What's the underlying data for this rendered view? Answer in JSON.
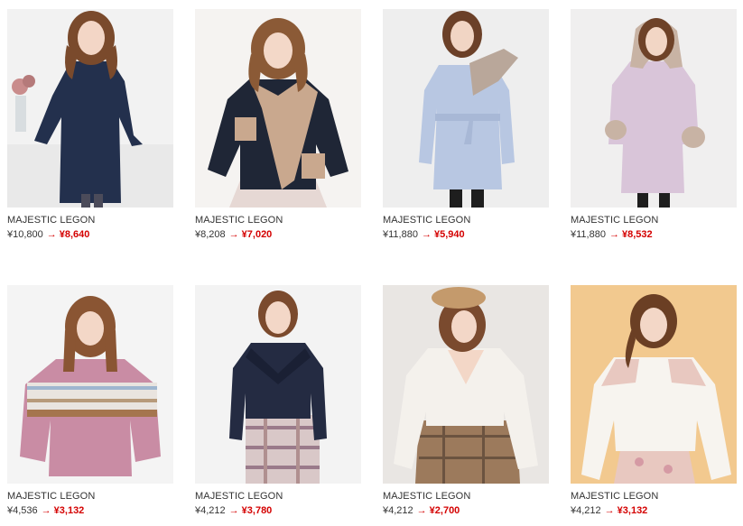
{
  "products": [
    {
      "brand": "MAJESTIC LEGON",
      "old_price": "¥10,800",
      "arrow": "→",
      "new_price": "¥8,640",
      "bg": "#f2f2f2",
      "garment": "#23304d",
      "accent": "#2c3a5c",
      "fur": "",
      "hair": "#7a4a2c"
    },
    {
      "brand": "MAJESTIC LEGON",
      "old_price": "¥8,208",
      "arrow": "→",
      "new_price": "¥7,020",
      "bg": "#f5f3f1",
      "garment": "#1f2636",
      "accent": "#c9a88e",
      "fur": "#c9a88e",
      "hair": "#8b5a36"
    },
    {
      "brand": "MAJESTIC LEGON",
      "old_price": "¥11,880",
      "arrow": "→",
      "new_price": "¥5,940",
      "bg": "#eeeeee",
      "garment": "#b8c7e2",
      "accent": "#a8b8d6",
      "fur": "#b9a79a",
      "hair": "#6b4028"
    },
    {
      "brand": "MAJESTIC LEGON",
      "old_price": "¥11,880",
      "arrow": "→",
      "new_price": "¥8,532",
      "bg": "#f0efef",
      "garment": "#d9c5d9",
      "accent": "#cdb6cf",
      "fur": "#c8b3a4",
      "hair": "#6e4228"
    },
    {
      "brand": "MAJESTIC LEGON",
      "old_price": "¥4,536",
      "arrow": "→",
      "new_price": "¥3,132",
      "bg": "#f4f4f4",
      "garment": "#c98ca4",
      "accent": "#e9e4df",
      "fur": "#a5754e",
      "hair": "#8a5533"
    },
    {
      "brand": "MAJESTIC LEGON",
      "old_price": "¥4,212",
      "arrow": "→",
      "new_price": "¥3,780",
      "bg": "#f3f3f3",
      "garment": "#242b42",
      "accent": "#d9c8c8",
      "fur": "",
      "hair": "#7b4a2d"
    },
    {
      "brand": "MAJESTIC LEGON",
      "old_price": "¥4,212",
      "arrow": "→",
      "new_price": "¥2,700",
      "bg": "#e9e6e3",
      "garment": "#f4f1ec",
      "accent": "#9c7a5c",
      "fur": "",
      "hair": "#7a4a2e"
    },
    {
      "brand": "MAJESTIC LEGON",
      "old_price": "¥4,212",
      "arrow": "→",
      "new_price": "¥3,132",
      "bg": "#f2c98f",
      "garment": "#f7f4ef",
      "accent": "#e8c8c0",
      "fur": "",
      "hair": "#6b3f24"
    }
  ]
}
